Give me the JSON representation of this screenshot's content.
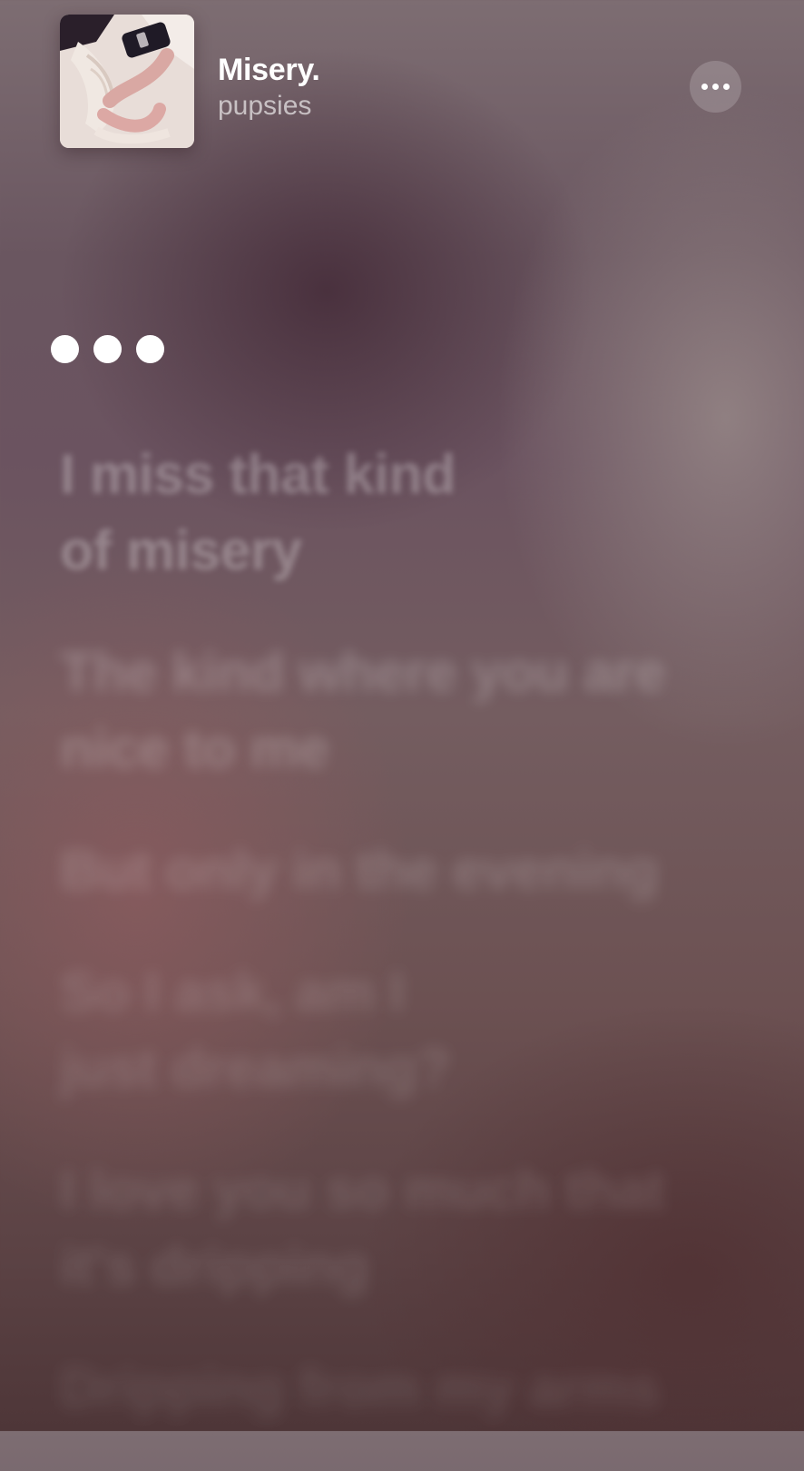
{
  "now_playing": {
    "title": "Misery.",
    "artist": "pupsies",
    "artwork_icon": "album-art"
  },
  "header": {
    "more_icon": "ellipsis-icon"
  },
  "interlude": {
    "icon": "instrumental-dots-icon",
    "dots": 3
  },
  "lyrics": [
    [
      "I miss that kind",
      "of misery"
    ],
    [
      "The kind where you are",
      "nice to me"
    ],
    [
      "But only in the evening"
    ],
    [
      "So I ask, am I",
      "just dreaming?"
    ],
    [
      "I love you so much that",
      "it's dripping"
    ],
    [
      "Dripping from my arms"
    ]
  ],
  "colors": {
    "text_primary": "#ffffff",
    "text_secondary": "rgba(255,255,255,0.62)",
    "lyric_inactive": "rgba(255,255,255,0.30)",
    "background_top": "#7d6d72",
    "background_bottom": "#4e3638"
  }
}
